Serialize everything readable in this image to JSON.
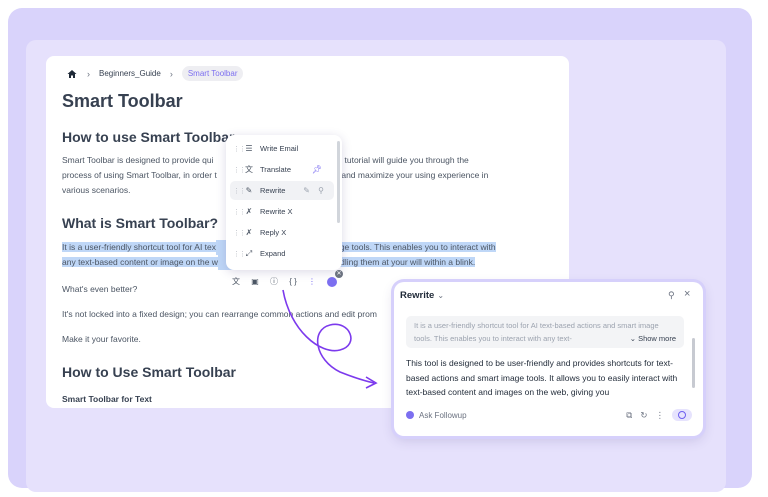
{
  "breadcrumb": {
    "home": "home-icon",
    "items": [
      "Beginners_Guide",
      "Smart Toolbar"
    ]
  },
  "doc": {
    "title": "Smart Toolbar",
    "h_how": "How to use Smart Toolbar",
    "intro_1": "Smart Toolbar is designed to provide qui",
    "intro_2": ". This tutorial will guide you through the",
    "intro_3": "process of using Smart Toolbar, in order t",
    "intro_4": "hod and maximize your using experience in",
    "intro_5": "various scenarios.",
    "h_what": "What is Smart Toolbar?",
    "hl_1a": "It is a user-friendly shortcut tool for AI tex",
    "hl_1b": "mage tools. This enables you to interact with",
    "hl_2a": "any text-based content or image on the w",
    "hl_2b": "handling them at your will within a blink.",
    "better": "What's even better?",
    "not_locked_a": "It's not locked into a fixed design; you can rearrange c",
    "not_locked_b": "ommon actions and edit prom",
    "favorite": "Make it your favorite.",
    "h_how2": "How to Use Smart Toolbar",
    "h_text": "Smart Toolbar for Text"
  },
  "menu": {
    "items": [
      {
        "label": "Write Email",
        "icon": "lines-icon"
      },
      {
        "label": "Translate",
        "icon": "translate-icon"
      },
      {
        "label": "Rewrite",
        "icon": "pencil-icon"
      },
      {
        "label": "Rewrite X",
        "icon": "x-logo-icon"
      },
      {
        "label": "Reply X",
        "icon": "x-logo-icon"
      },
      {
        "label": "Expand",
        "icon": "expand-icon"
      }
    ]
  },
  "toolbar": {
    "icons": [
      "translate-icon",
      "bookmark-icon",
      "help-icon",
      "code-icon",
      "more-icon",
      "bot-icon"
    ],
    "code_label": "{ }"
  },
  "panel": {
    "title": "Rewrite",
    "quote": "It is a user-friendly shortcut tool for AI text-based actions and smart image tools. This enables you to interact with any text-",
    "show_more": "Show more",
    "answer": "This tool is designed to be user-friendly and provides shortcuts for text-based actions and smart image tools. It allows you to easily interact with text-based content and images on the web, giving you",
    "followup": "Ask Followup"
  },
  "colors": {
    "accent": "#7c6ff0",
    "highlight": "#bfd7f7",
    "background": "#d9d3fb"
  }
}
